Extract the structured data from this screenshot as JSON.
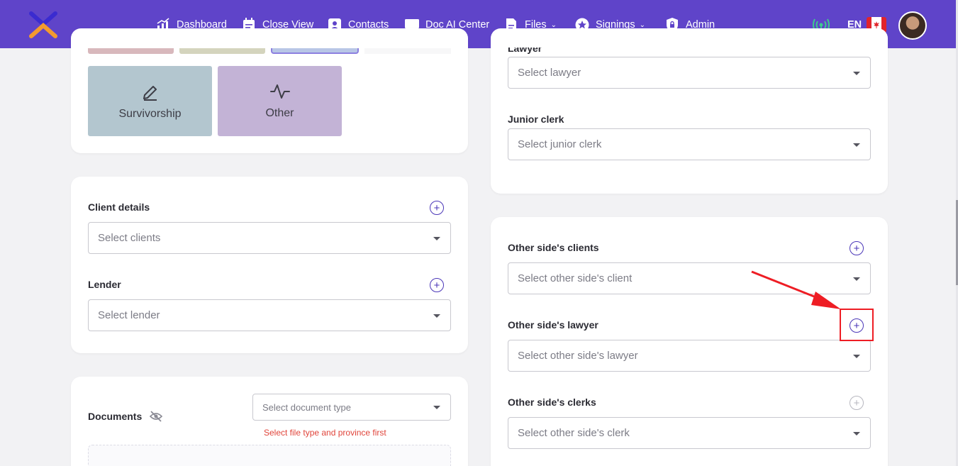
{
  "nav": {
    "items": [
      {
        "label": "Dashboard",
        "icon": "chart-icon"
      },
      {
        "label": "Close View",
        "icon": "calendar-icon"
      },
      {
        "label": "Contacts",
        "icon": "contact-icon"
      },
      {
        "label": "Doc AI Center",
        "icon": "monitor-icon"
      },
      {
        "label": "Files",
        "icon": "file-icon"
      },
      {
        "label": "Signings",
        "icon": "star-icon"
      },
      {
        "label": "Admin",
        "icon": "lock-icon"
      }
    ],
    "language": "EN",
    "chevron": "⌄"
  },
  "tiles": [
    {
      "label": "Survivorship",
      "icon": "pencil-icon",
      "color": "#b3c6cf"
    },
    {
      "label": "Other",
      "icon": "activity-icon",
      "color": "#c3b3d6"
    }
  ],
  "client_card": {
    "client_label": "Client details",
    "client_placeholder": "Select clients",
    "lender_label": "Lender",
    "lender_placeholder": "Select lender"
  },
  "documents_card": {
    "label": "Documents",
    "type_placeholder": "Select document type",
    "error": "Select file type and province first"
  },
  "staff_card": {
    "lawyer_label": "Lawyer",
    "lawyer_placeholder": "Select lawyer",
    "junior_label": "Junior clerk",
    "junior_placeholder": "Select junior clerk"
  },
  "other_side_card": {
    "clients_label": "Other side's clients",
    "clients_placeholder": "Select other side's client",
    "lawyer_label": "Other side's lawyer",
    "lawyer_placeholder": "Select other side's lawyer",
    "clerks_label": "Other side's clerks",
    "clerks_placeholder": "Select other side's clerk"
  },
  "colors": {
    "nav": "#5f44c9",
    "accent": "#4b37b8",
    "error": "#e0443a",
    "annotation": "#ee1d24"
  }
}
